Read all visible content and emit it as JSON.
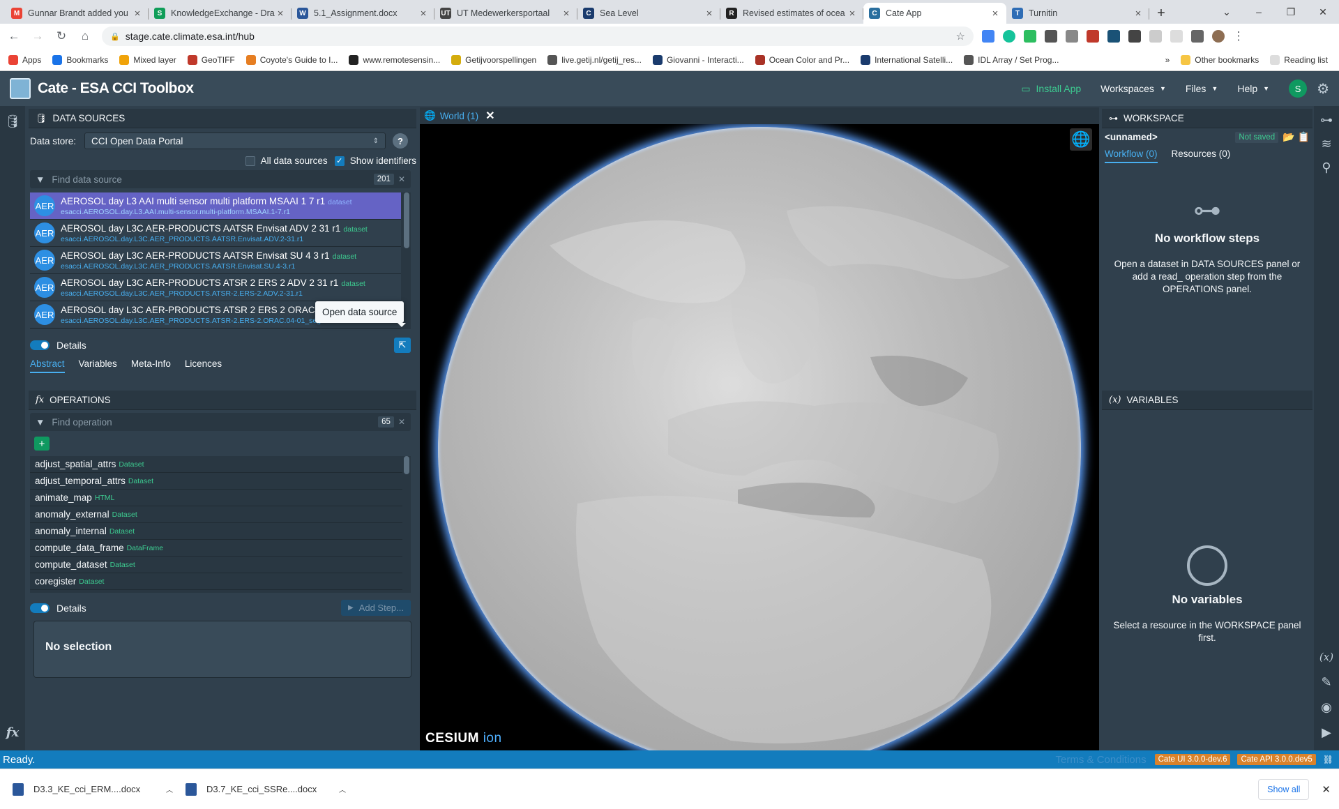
{
  "browser": {
    "tabs": [
      {
        "title": "Gunnar Brandt added you",
        "fav": "M",
        "color": "#ea4335"
      },
      {
        "title": "KnowledgeExchange - Dra",
        "fav": "S",
        "color": "#0f9d58"
      },
      {
        "title": "5.1_Assignment.docx",
        "fav": "W",
        "color": "#2b579a"
      },
      {
        "title": "UT Medewerkersportaal",
        "fav": "UT",
        "color": "#444"
      },
      {
        "title": "Sea Level",
        "fav": "C",
        "color": "#1a3b6d"
      },
      {
        "title": "Revised estimates of ocea",
        "fav": "R",
        "color": "#222"
      },
      {
        "title": "Cate App",
        "fav": "C",
        "color": "#2a6f9e"
      },
      {
        "title": "Turnitin",
        "fav": "T",
        "color": "#2f6db5"
      }
    ],
    "url": "stage.cate.climate.esa.int/hub",
    "bookmarks": [
      "Apps",
      "Bookmarks",
      "Mixed layer",
      "GeoTIFF",
      "Coyote's Guide to I...",
      "www.remotesensin...",
      "Getijvoorspellingen",
      "live.getij.nl/getij_res...",
      "Giovanni - Interacti...",
      "Ocean Color and Pr...",
      "International Satelli...",
      "IDL Array / Set Prog..."
    ],
    "other_bookmarks": "Other bookmarks",
    "reading_list": "Reading list"
  },
  "app": {
    "title": "Cate - ESA CCI Toolbox",
    "install": "Install App",
    "menus": [
      "Workspaces",
      "Files",
      "Help"
    ],
    "avatar": "S"
  },
  "datasources": {
    "header": "DATA SOURCES",
    "store_label": "Data store:",
    "store_value": "CCI Open Data Portal",
    "all_sources": "All data sources",
    "show_ids": "Show identifiers",
    "search_placeholder": "Find data source",
    "count": "201",
    "items": [
      {
        "abbr": "AER",
        "title": "AEROSOL day L3 AAI multi sensor multi platform MSAAI 1 7 r1",
        "tag": "dataset",
        "id": "esacci.AEROSOL.day.L3.AAI.multi-sensor.multi-platform.MSAAI.1-7.r1"
      },
      {
        "abbr": "AER",
        "title": "AEROSOL day L3C AER-PRODUCTS AATSR Envisat ADV 2 31 r1",
        "tag": "dataset",
        "id": "esacci.AEROSOL.day.L3C.AER_PRODUCTS.AATSR.Envisat.ADV.2-31.r1"
      },
      {
        "abbr": "AER",
        "title": "AEROSOL day L3C AER-PRODUCTS AATSR Envisat SU 4 3 r1",
        "tag": "dataset",
        "id": "esacci.AEROSOL.day.L3C.AER_PRODUCTS.AATSR.Envisat.SU.4-3.r1"
      },
      {
        "abbr": "AER",
        "title": "AEROSOL day L3C AER-PRODUCTS ATSR 2 ERS 2 ADV 2 31 r1",
        "tag": "dataset",
        "id": "esacci.AEROSOL.day.L3C.AER_PRODUCTS.ATSR-2.ERS-2.ADV.2-31.r1"
      },
      {
        "abbr": "AER",
        "title": "AEROSOL day L3C AER-PRODUCTS ATSR 2 ERS 2 ORAC 04",
        "tag": "",
        "id": "esacci.AEROSOL.day.L3C.AER_PRODUCTS.ATSR-2.ERS-2.ORAC.04-01_seg-"
      }
    ],
    "tooltip": "Open data source",
    "details": "Details",
    "tabs": [
      "Abstract",
      "Variables",
      "Meta-Info",
      "Licences"
    ]
  },
  "operations": {
    "header": "OPERATIONS",
    "search_placeholder": "Find operation",
    "count": "65",
    "items": [
      {
        "name": "adjust_spatial_attrs",
        "tag": "Dataset"
      },
      {
        "name": "adjust_temporal_attrs",
        "tag": "Dataset"
      },
      {
        "name": "animate_map",
        "tag": "HTML"
      },
      {
        "name": "anomaly_external",
        "tag": "Dataset"
      },
      {
        "name": "anomaly_internal",
        "tag": "Dataset"
      },
      {
        "name": "compute_data_frame",
        "tag": "DataFrame"
      },
      {
        "name": "compute_dataset",
        "tag": "Dataset"
      },
      {
        "name": "coregister",
        "tag": "Dataset"
      }
    ],
    "details": "Details",
    "add_step": "Add Step...",
    "no_selection": "No selection"
  },
  "view": {
    "tab": "World (1)",
    "cesium": "CESIUM",
    "ion": "ion"
  },
  "workspace": {
    "header": "WORKSPACE",
    "name": "<unnamed>",
    "saved": "Not saved",
    "tab_workflow": "Workflow (0)",
    "tab_resources": "Resources (0)",
    "empty_title": "No workflow steps",
    "empty_text": "Open a dataset in DATA SOURCES panel or add a read_ operation step from the OPERATIONS panel."
  },
  "variables": {
    "header": "VARIABLES",
    "empty_title": "No variables",
    "empty_text": "Select a resource in the WORKSPACE panel first."
  },
  "status": {
    "text": "Ready.",
    "terms": "Terms & Conditions",
    "ui": "Cate UI 3.0.0-dev.6",
    "api": "Cate API 3.0.0.dev5"
  },
  "downloads": {
    "items": [
      "D3.3_KE_cci_ERM....docx",
      "D3.7_KE_cci_SSRe....docx"
    ],
    "show_all": "Show all"
  }
}
